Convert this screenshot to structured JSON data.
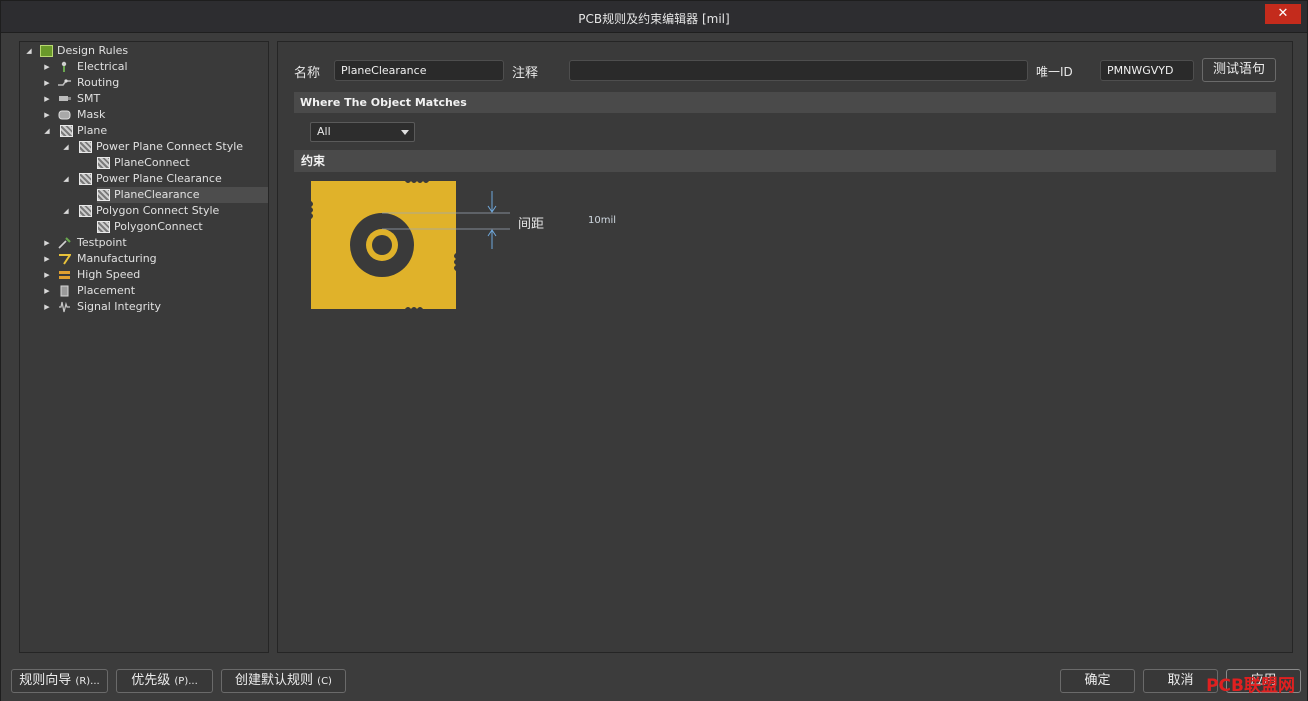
{
  "window": {
    "title": "PCB规则及约束编辑器 [mil]",
    "close_glyph": "✕"
  },
  "tree": {
    "root": "Design Rules",
    "items": [
      {
        "label": "Electrical",
        "icon": "electrical-icon"
      },
      {
        "label": "Routing",
        "icon": "routing-icon"
      },
      {
        "label": "SMT",
        "icon": "smt-icon"
      },
      {
        "label": "Mask",
        "icon": "mask-icon"
      },
      {
        "label": "Plane",
        "icon": "plane-icon"
      },
      {
        "label": "Power Plane Connect Style",
        "icon": "plane-rule-icon"
      },
      {
        "label": "PlaneConnect",
        "icon": "plane-rule-icon"
      },
      {
        "label": "Power Plane Clearance",
        "icon": "plane-rule-icon"
      },
      {
        "label": "PlaneClearance",
        "icon": "plane-rule-icon"
      },
      {
        "label": "Polygon Connect Style",
        "icon": "plane-rule-icon"
      },
      {
        "label": "PolygonConnect",
        "icon": "plane-rule-icon"
      },
      {
        "label": "Testpoint",
        "icon": "testpoint-icon"
      },
      {
        "label": "Manufacturing",
        "icon": "manufacturing-icon"
      },
      {
        "label": "High Speed",
        "icon": "high-speed-icon"
      },
      {
        "label": "Placement",
        "icon": "placement-icon"
      },
      {
        "label": "Signal Integrity",
        "icon": "signal-integrity-icon"
      }
    ],
    "selected": "PlaneClearance"
  },
  "rule": {
    "name_label": "名称",
    "name_value": "PlaneClearance",
    "comment_label": "注释",
    "comment_value": "",
    "uid_label": "唯一ID",
    "uid_value": "PMNWGVYD",
    "test_button": "测试语句"
  },
  "where": {
    "title": "Where The Object Matches",
    "scope_value": "All"
  },
  "constraints": {
    "title": "约束",
    "clearance_label": "间距",
    "clearance_value": "10mil"
  },
  "colors": {
    "copper": "#e0b22a",
    "hole": "#3a3a3a",
    "dimension": "#6fa8dc"
  },
  "footer": {
    "wizard": "规则向导",
    "wizard_hint": "(R)...",
    "priority": "优先级",
    "priority_hint": "(P)...",
    "create_default": "创建默认规则",
    "create_default_hint": "(C)",
    "ok": "确定",
    "cancel": "取消",
    "apply": "应用"
  },
  "watermark": "PCB联盟网"
}
